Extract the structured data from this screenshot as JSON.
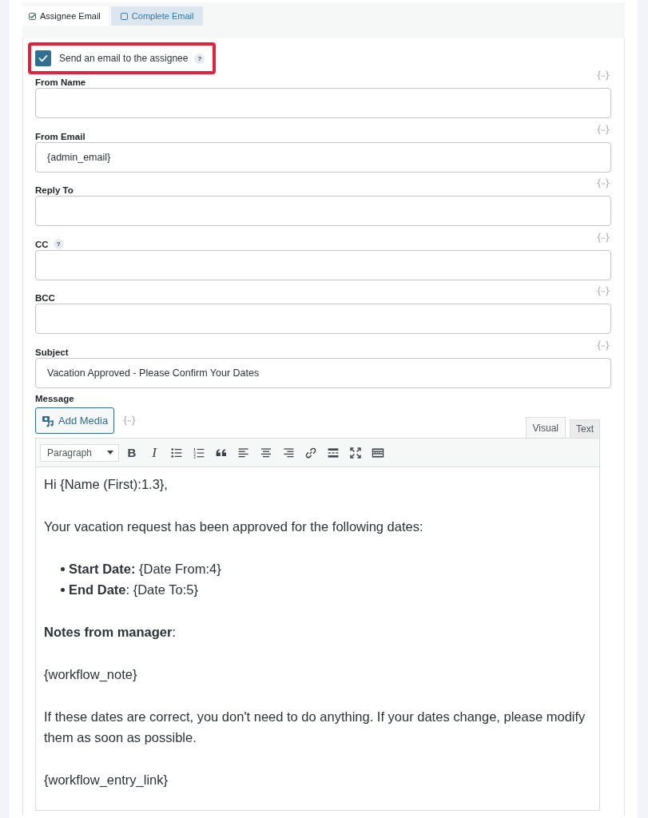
{
  "email_tabs": [
    {
      "label": "Assignee Email",
      "checked": true,
      "selected": true
    },
    {
      "label": "Complete Email",
      "checked": false,
      "selected": false
    }
  ],
  "send_email": {
    "label": "Send an email to the assignee",
    "help": "?",
    "checked": true,
    "highlighted": true
  },
  "fields": [
    {
      "label": "From Name"
    },
    {
      "label": "From Email",
      "value": "{admin_email}"
    },
    {
      "label": "Reply To"
    },
    {
      "label": "CC",
      "help": "?"
    },
    {
      "label": "BCC"
    },
    {
      "label": "Subject",
      "value": "Vacation Approved - Please Confirm Your Dates"
    }
  ],
  "message": {
    "label": "Message",
    "add_media": "Add Media",
    "editor_tabs": [
      {
        "label": "Visual",
        "selected": true
      },
      {
        "label": "Text",
        "selected": false
      }
    ],
    "format": "Paragraph",
    "toolbar": [
      {
        "kind": "bold",
        "text": "B"
      },
      {
        "kind": "italic",
        "text": "I"
      },
      {
        "kind": "bullet_list"
      },
      {
        "kind": "numbered_list"
      },
      {
        "kind": "blockquote"
      },
      {
        "kind": "align_left"
      },
      {
        "kind": "align_center"
      },
      {
        "kind": "align_right"
      },
      {
        "kind": "link"
      },
      {
        "kind": "read_more"
      },
      {
        "kind": "fullscreen"
      },
      {
        "kind": "toolbar_toggle"
      }
    ],
    "body": [
      {
        "kind": "paragraph",
        "text": "Hi {Name (First):1.3},"
      },
      {
        "kind": "paragraph",
        "text": "Your vacation request has been approved for the following dates:"
      },
      {
        "kind": "list",
        "items": [
          "**Start Date:** {Date From:4}",
          "**End Date**: {Date To:5}"
        ]
      },
      {
        "kind": "paragraph",
        "text": "**Notes from manager**:"
      },
      {
        "kind": "paragraph",
        "text": "{workflow_note}"
      },
      {
        "kind": "paragraph",
        "text": "If these dates are correct, you don't need to do anything. If your dates change, please modify them as soon as possible."
      },
      {
        "kind": "paragraph",
        "text": "{workflow_entry_link}"
      }
    ]
  }
}
